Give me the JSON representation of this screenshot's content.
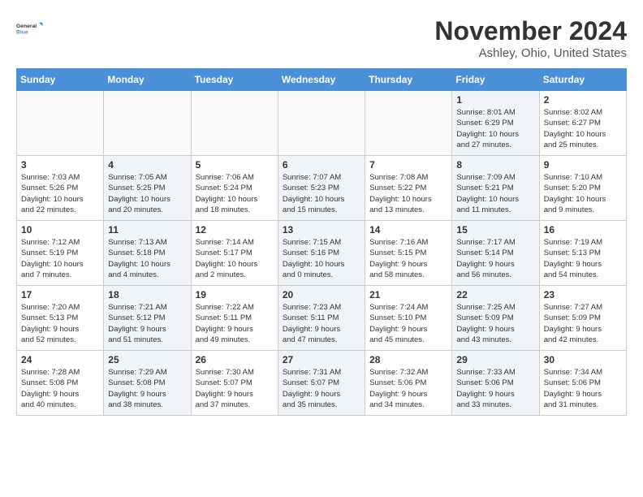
{
  "header": {
    "logo_line1": "General",
    "logo_line2": "Blue",
    "month": "November 2024",
    "location": "Ashley, Ohio, United States"
  },
  "days_of_week": [
    "Sunday",
    "Monday",
    "Tuesday",
    "Wednesday",
    "Thursday",
    "Friday",
    "Saturday"
  ],
  "weeks": [
    [
      {
        "day": "",
        "info": "",
        "empty": true
      },
      {
        "day": "",
        "info": "",
        "empty": true
      },
      {
        "day": "",
        "info": "",
        "empty": true
      },
      {
        "day": "",
        "info": "",
        "empty": true
      },
      {
        "day": "",
        "info": "",
        "empty": true
      },
      {
        "day": "1",
        "info": "Sunrise: 8:01 AM\nSunset: 6:29 PM\nDaylight: 10 hours\nand 27 minutes.",
        "shaded": true
      },
      {
        "day": "2",
        "info": "Sunrise: 8:02 AM\nSunset: 6:27 PM\nDaylight: 10 hours\nand 25 minutes.",
        "shaded": false
      }
    ],
    [
      {
        "day": "3",
        "info": "Sunrise: 7:03 AM\nSunset: 5:26 PM\nDaylight: 10 hours\nand 22 minutes.",
        "shaded": false
      },
      {
        "day": "4",
        "info": "Sunrise: 7:05 AM\nSunset: 5:25 PM\nDaylight: 10 hours\nand 20 minutes.",
        "shaded": true
      },
      {
        "day": "5",
        "info": "Sunrise: 7:06 AM\nSunset: 5:24 PM\nDaylight: 10 hours\nand 18 minutes.",
        "shaded": false
      },
      {
        "day": "6",
        "info": "Sunrise: 7:07 AM\nSunset: 5:23 PM\nDaylight: 10 hours\nand 15 minutes.",
        "shaded": true
      },
      {
        "day": "7",
        "info": "Sunrise: 7:08 AM\nSunset: 5:22 PM\nDaylight: 10 hours\nand 13 minutes.",
        "shaded": false
      },
      {
        "day": "8",
        "info": "Sunrise: 7:09 AM\nSunset: 5:21 PM\nDaylight: 10 hours\nand 11 minutes.",
        "shaded": true
      },
      {
        "day": "9",
        "info": "Sunrise: 7:10 AM\nSunset: 5:20 PM\nDaylight: 10 hours\nand 9 minutes.",
        "shaded": false
      }
    ],
    [
      {
        "day": "10",
        "info": "Sunrise: 7:12 AM\nSunset: 5:19 PM\nDaylight: 10 hours\nand 7 minutes.",
        "shaded": false
      },
      {
        "day": "11",
        "info": "Sunrise: 7:13 AM\nSunset: 5:18 PM\nDaylight: 10 hours\nand 4 minutes.",
        "shaded": true
      },
      {
        "day": "12",
        "info": "Sunrise: 7:14 AM\nSunset: 5:17 PM\nDaylight: 10 hours\nand 2 minutes.",
        "shaded": false
      },
      {
        "day": "13",
        "info": "Sunrise: 7:15 AM\nSunset: 5:16 PM\nDaylight: 10 hours\nand 0 minutes.",
        "shaded": true
      },
      {
        "day": "14",
        "info": "Sunrise: 7:16 AM\nSunset: 5:15 PM\nDaylight: 9 hours\nand 58 minutes.",
        "shaded": false
      },
      {
        "day": "15",
        "info": "Sunrise: 7:17 AM\nSunset: 5:14 PM\nDaylight: 9 hours\nand 56 minutes.",
        "shaded": true
      },
      {
        "day": "16",
        "info": "Sunrise: 7:19 AM\nSunset: 5:13 PM\nDaylight: 9 hours\nand 54 minutes.",
        "shaded": false
      }
    ],
    [
      {
        "day": "17",
        "info": "Sunrise: 7:20 AM\nSunset: 5:13 PM\nDaylight: 9 hours\nand 52 minutes.",
        "shaded": false
      },
      {
        "day": "18",
        "info": "Sunrise: 7:21 AM\nSunset: 5:12 PM\nDaylight: 9 hours\nand 51 minutes.",
        "shaded": true
      },
      {
        "day": "19",
        "info": "Sunrise: 7:22 AM\nSunset: 5:11 PM\nDaylight: 9 hours\nand 49 minutes.",
        "shaded": false
      },
      {
        "day": "20",
        "info": "Sunrise: 7:23 AM\nSunset: 5:11 PM\nDaylight: 9 hours\nand 47 minutes.",
        "shaded": true
      },
      {
        "day": "21",
        "info": "Sunrise: 7:24 AM\nSunset: 5:10 PM\nDaylight: 9 hours\nand 45 minutes.",
        "shaded": false
      },
      {
        "day": "22",
        "info": "Sunrise: 7:25 AM\nSunset: 5:09 PM\nDaylight: 9 hours\nand 43 minutes.",
        "shaded": true
      },
      {
        "day": "23",
        "info": "Sunrise: 7:27 AM\nSunset: 5:09 PM\nDaylight: 9 hours\nand 42 minutes.",
        "shaded": false
      }
    ],
    [
      {
        "day": "24",
        "info": "Sunrise: 7:28 AM\nSunset: 5:08 PM\nDaylight: 9 hours\nand 40 minutes.",
        "shaded": false
      },
      {
        "day": "25",
        "info": "Sunrise: 7:29 AM\nSunset: 5:08 PM\nDaylight: 9 hours\nand 38 minutes.",
        "shaded": true
      },
      {
        "day": "26",
        "info": "Sunrise: 7:30 AM\nSunset: 5:07 PM\nDaylight: 9 hours\nand 37 minutes.",
        "shaded": false
      },
      {
        "day": "27",
        "info": "Sunrise: 7:31 AM\nSunset: 5:07 PM\nDaylight: 9 hours\nand 35 minutes.",
        "shaded": true
      },
      {
        "day": "28",
        "info": "Sunrise: 7:32 AM\nSunset: 5:06 PM\nDaylight: 9 hours\nand 34 minutes.",
        "shaded": false
      },
      {
        "day": "29",
        "info": "Sunrise: 7:33 AM\nSunset: 5:06 PM\nDaylight: 9 hours\nand 33 minutes.",
        "shaded": true
      },
      {
        "day": "30",
        "info": "Sunrise: 7:34 AM\nSunset: 5:06 PM\nDaylight: 9 hours\nand 31 minutes.",
        "shaded": false
      }
    ]
  ]
}
